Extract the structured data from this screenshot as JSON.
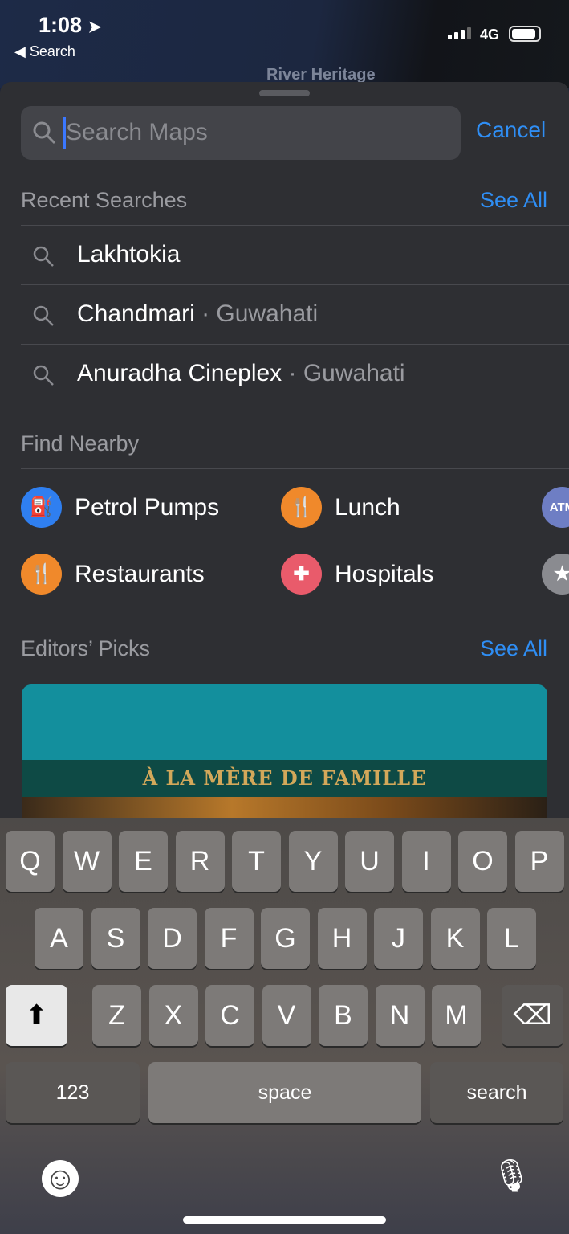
{
  "status_bar": {
    "time": "1:08",
    "back_label": "Search",
    "network": "4G",
    "battery_percent": 90,
    "signal_bars": 3
  },
  "map": {
    "label": "River Heritage"
  },
  "search": {
    "placeholder": "Search Maps",
    "cancel_label": "Cancel"
  },
  "recent": {
    "title": "Recent Searches",
    "see_all": "See All",
    "items": [
      {
        "name": "Lakhtokia",
        "sub": ""
      },
      {
        "name": "Chandmari",
        "sub": " · Guwahati"
      },
      {
        "name": "Anuradha Cineplex",
        "sub": " · Guwahati"
      }
    ]
  },
  "nearby": {
    "title": "Find Nearby",
    "items": [
      {
        "label": "Petrol Pumps",
        "icon": "fuel-icon",
        "color": "#2f7ff0",
        "glyph": "⛽"
      },
      {
        "label": "Lunch",
        "icon": "fork-knife-icon",
        "color": "#f0892b",
        "glyph": "🍴"
      },
      {
        "label": "",
        "icon": "atm-icon",
        "color": "#6e7ec4",
        "glyph": "ATM"
      },
      {
        "label": "Restaurants",
        "icon": "fork-knife-icon",
        "color": "#f0892b",
        "glyph": "🍴"
      },
      {
        "label": "Hospitals",
        "icon": "plus-icon",
        "color": "#e95b6b",
        "glyph": "✚"
      },
      {
        "label": "",
        "icon": "star-icon",
        "color": "#8a8b90",
        "glyph": "★"
      }
    ]
  },
  "editors": {
    "title": "Editors’ Picks",
    "see_all": "See All",
    "card_sign": "À LA MÈRE DE FAMILLE"
  },
  "keyboard": {
    "row1": [
      "Q",
      "W",
      "E",
      "R",
      "T",
      "Y",
      "U",
      "I",
      "O",
      "P"
    ],
    "row2": [
      "A",
      "S",
      "D",
      "F",
      "G",
      "H",
      "J",
      "K",
      "L"
    ],
    "row3": [
      "Z",
      "X",
      "C",
      "V",
      "B",
      "N",
      "M"
    ],
    "numbers": "123",
    "space": "space",
    "search": "search",
    "shift_glyph": "⬆",
    "delete_glyph": "⌫",
    "emoji_glyph": "☺",
    "mic_glyph": "🎙"
  }
}
